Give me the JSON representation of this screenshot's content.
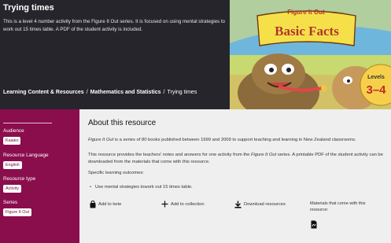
{
  "header": {
    "title": "Trying times",
    "description": "This is a level 4 number activity from the Figure It Out series. It is focused on using mental strategies to work out 15 times table. A PDF of the student activity is included."
  },
  "breadcrumb": {
    "items": [
      "Learning Content & Resources",
      "Mathematics and Statistics"
    ],
    "current": "Trying times",
    "separator": "/"
  },
  "cover": {
    "top_text": "Figure It Out",
    "title": "Basic Facts",
    "levels_label": "Levels",
    "levels_value": "3–4"
  },
  "sidebar": {
    "audience_label": "Audience",
    "audience_value": "Kaiako",
    "language_label": "Resource Language",
    "language_value": "English",
    "type_label": "Resource type",
    "type_value": "Activity",
    "series_label": "Series",
    "series_value": "Figure It Out"
  },
  "main": {
    "title": "About this resource",
    "p1_italic": "Figure It Out",
    "p1_rest": " is a series of 80 books published between 1999 and 2009 to support teaching and learning in New Zealand classrooms.",
    "p2_a": "This resource provides the teachers' notes and answers for one activity from the ",
    "p2_italic": "Figure It Out",
    "p2_b": " series. A printable PDF of the student activity can be downloaded from the materials that come with this resource.",
    "outcomes_label": "Specific learning outcomes:",
    "outcome_1": "Use mental strategies towork out 15 times table.",
    "add_kete": "Add to kete",
    "add_collection": "Add to collection",
    "download": "Download resources",
    "materials_label": "Materials that come with this resource:"
  },
  "colors": {
    "header_bg": "#26252b",
    "sidebar_bg": "#8a0d4c",
    "main_bg": "#efefef"
  }
}
